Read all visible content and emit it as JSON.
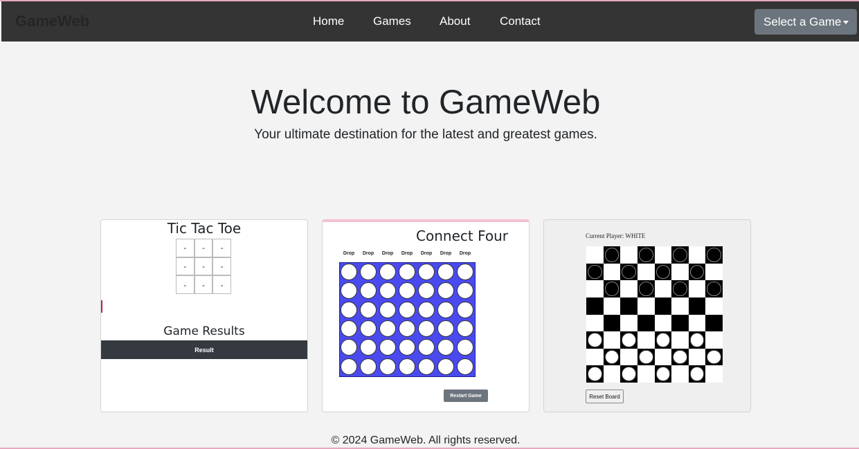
{
  "navbar": {
    "brand": "GameWeb",
    "links": [
      "Home",
      "Games",
      "About",
      "Contact"
    ],
    "select_label": "Select a Game"
  },
  "hero": {
    "title": "Welcome to GameWeb",
    "subtitle": "Your ultimate destination for the latest and greatest games."
  },
  "tictactoe": {
    "title": "Tic Tac Toe",
    "cells": [
      "-",
      "-",
      "-",
      "-",
      "-",
      "-",
      "-",
      "-",
      "-"
    ],
    "results_title": "Game Results",
    "results_header": "Result"
  },
  "connect_four": {
    "title": "Connect Four",
    "drop_label": "Drop",
    "columns": 7,
    "rows": 6,
    "restart_label": "Restart Game"
  },
  "checkers": {
    "status": "Current Player: WHITE",
    "reset_label": "Reset Board",
    "board": [
      "_b_b_b_b",
      "b_b_b_b_",
      "_b_b_b_b",
      "........",
      "........",
      "w_w_w_w_",
      "_w_w_w_w",
      "w_w_w_w_"
    ]
  },
  "footer": {
    "text": "© 2024 GameWeb. All rights reserved."
  },
  "colors": {
    "navbar_bg": "#343434",
    "c4_board": "#4a4aef",
    "button_gray": "#6c757d",
    "results_header": "#343a40"
  }
}
